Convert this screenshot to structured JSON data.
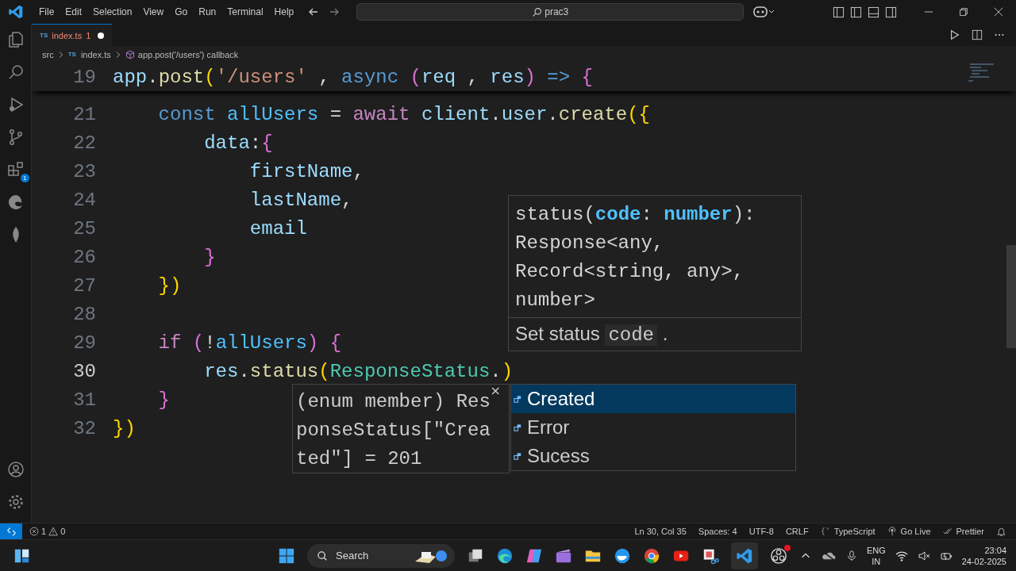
{
  "menu": [
    "File",
    "Edit",
    "Selection",
    "View",
    "Go",
    "Run",
    "Terminal",
    "Help"
  ],
  "command_center": {
    "value": "prac3"
  },
  "tab": {
    "file_icon": "TS",
    "label": "index.ts",
    "problems": "1",
    "modified": true
  },
  "breadcrumb": [
    {
      "label": "src"
    },
    {
      "file_icon": "TS",
      "label": "index.ts"
    },
    {
      "label": "app.post('/users') callback"
    }
  ],
  "extensions_badge": "1",
  "sticky_line": {
    "number": "19",
    "tokens": [
      {
        "text": "app",
        "kind": "var"
      },
      {
        "text": ".",
        "kind": "plain"
      },
      {
        "text": "post",
        "kind": "fn"
      },
      {
        "text": "(",
        "kind": "b1"
      },
      {
        "text": "'/users'",
        "kind": "str"
      },
      {
        "text": " , ",
        "kind": "plain"
      },
      {
        "text": "async",
        "kind": "kw"
      },
      {
        "text": " (",
        "kind": "b2"
      },
      {
        "text": "req",
        "kind": "var"
      },
      {
        "text": " , ",
        "kind": "plain"
      },
      {
        "text": "res",
        "kind": "var"
      },
      {
        "text": ")",
        "kind": "b2"
      },
      {
        "text": " =>",
        "kind": "kw"
      },
      {
        "text": " {",
        "kind": "b2"
      }
    ]
  },
  "code_lines": [
    {
      "number": "21",
      "current": false,
      "tokens": [
        {
          "text": "    const",
          "kind": "kw"
        },
        {
          "text": " allUsers",
          "kind": "const"
        },
        {
          "text": " = ",
          "kind": "plain"
        },
        {
          "text": "await",
          "kind": "ctrl"
        },
        {
          "text": " client",
          "kind": "var"
        },
        {
          "text": ".",
          "kind": "plain"
        },
        {
          "text": "user",
          "kind": "var"
        },
        {
          "text": ".",
          "kind": "plain"
        },
        {
          "text": "create",
          "kind": "fn"
        },
        {
          "text": "({",
          "kind": "b1"
        }
      ]
    },
    {
      "number": "22",
      "current": false,
      "tokens": [
        {
          "text": "        data",
          "kind": "var"
        },
        {
          "text": ":",
          "kind": "plain"
        },
        {
          "text": "{",
          "kind": "b2"
        }
      ]
    },
    {
      "number": "23",
      "current": false,
      "tokens": [
        {
          "text": "            firstName",
          "kind": "var"
        },
        {
          "text": ",",
          "kind": "plain"
        }
      ]
    },
    {
      "number": "24",
      "current": false,
      "tokens": [
        {
          "text": "            lastName",
          "kind": "var"
        },
        {
          "text": ",",
          "kind": "plain"
        }
      ]
    },
    {
      "number": "25",
      "current": false,
      "tokens": [
        {
          "text": "            email",
          "kind": "var"
        }
      ]
    },
    {
      "number": "26",
      "current": false,
      "tokens": [
        {
          "text": "        }",
          "kind": "b2"
        }
      ]
    },
    {
      "number": "27",
      "current": false,
      "tokens": [
        {
          "text": "    })",
          "kind": "b1"
        }
      ]
    },
    {
      "number": "28",
      "current": false
    },
    {
      "number": "29",
      "current": false,
      "tokens": [
        {
          "text": "    if",
          "kind": "ctrl"
        },
        {
          "text": " (",
          "kind": "b2"
        },
        {
          "text": "!",
          "kind": "plain"
        },
        {
          "text": "allUsers",
          "kind": "const"
        },
        {
          "text": ")",
          "kind": "b2"
        },
        {
          "text": " {",
          "kind": "b2"
        }
      ]
    },
    {
      "number": "30",
      "current": true,
      "tokens": [
        {
          "text": "        res",
          "kind": "var"
        },
        {
          "text": ".",
          "kind": "plain"
        },
        {
          "text": "status",
          "kind": "fn"
        },
        {
          "text": "(",
          "kind": "b1"
        },
        {
          "text": "ResponseStatus",
          "kind": "type"
        },
        {
          "text": ".",
          "kind": "plain"
        },
        {
          "text": ")",
          "kind": "b1"
        }
      ]
    },
    {
      "number": "31",
      "current": false,
      "tokens": [
        {
          "text": "    }",
          "kind": "b2"
        }
      ]
    },
    {
      "number": "32",
      "current": false,
      "tokens": [
        {
          "text": "})",
          "kind": "b1"
        }
      ]
    }
  ],
  "hover": {
    "signature": [
      [
        {
          "text": "status(",
          "kind": "plain"
        },
        {
          "text": "code",
          "kind": "param"
        },
        {
          "text": ": ",
          "kind": "plain"
        },
        {
          "text": "number",
          "kind": "param"
        },
        {
          "text": "):",
          "kind": "plain"
        }
      ],
      [
        {
          "text": "Response<any,",
          "kind": "plain"
        }
      ],
      [
        {
          "text": "Record<string, any>,",
          "kind": "plain"
        }
      ],
      [
        {
          "text": "number>",
          "kind": "plain"
        }
      ]
    ],
    "doc": [
      {
        "text": "Set status ",
        "kind": "text"
      },
      {
        "text": "code",
        "kind": "code"
      },
      {
        "text": " .",
        "kind": "text"
      }
    ]
  },
  "suggestion_detail": {
    "text": "(enum member) ResponseStatus[\"Created\"] = 201",
    "close": "×"
  },
  "suggestions": [
    {
      "label": "Created",
      "selected": true
    },
    {
      "label": "Error",
      "selected": false
    },
    {
      "label": "Sucess",
      "selected": false
    }
  ],
  "status_bar": {
    "errors": "1",
    "warnings": "0",
    "items": [
      "Ln 30, Col 35",
      "Spaces: 4",
      "UTF-8",
      "CRLF",
      "TypeScript",
      "Go Live",
      "Prettier"
    ]
  },
  "taskbar": {
    "search_placeholder": "Search",
    "language": [
      "ENG",
      "IN"
    ],
    "time": "23:04",
    "date": "24-02-2025"
  }
}
